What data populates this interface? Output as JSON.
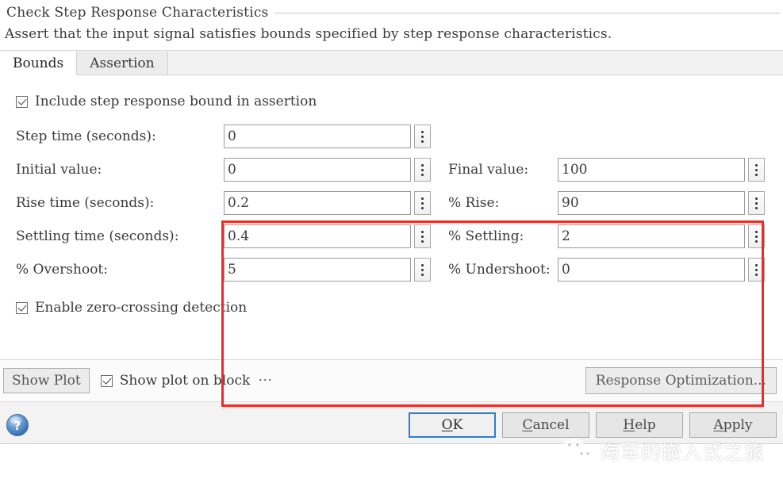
{
  "header": {
    "title": "Check Step Response Characteristics",
    "subtitle": "Assert that the input signal satisfies bounds specified by step response characteristics."
  },
  "tabs": [
    {
      "label": "Bounds",
      "active": true
    },
    {
      "label": "Assertion",
      "active": false
    }
  ],
  "panel": {
    "include_bound_checkbox": {
      "label": "Include step response bound in assertion",
      "checked": true
    },
    "fields": [
      {
        "left_label": "Step time (seconds):",
        "left_value": "0",
        "right_label": "",
        "right_value": null
      },
      {
        "left_label": "Initial value:",
        "left_value": "0",
        "right_label": "Final value:",
        "right_value": "100"
      },
      {
        "left_label": "Rise time (seconds):",
        "left_value": "0.2",
        "right_label": "% Rise:",
        "right_value": "90"
      },
      {
        "left_label": "Settling time (seconds):",
        "left_value": "0.4",
        "right_label": "% Settling:",
        "right_value": "2"
      },
      {
        "left_label": "% Overshoot:",
        "left_value": "5",
        "right_label": "% Undershoot:",
        "right_value": "0"
      }
    ],
    "zero_crossing_checkbox": {
      "label": "Enable zero-crossing detection",
      "checked": true
    },
    "annotation_rect_color": "#ee2b24"
  },
  "toolbar": {
    "show_plot_label": "Show Plot",
    "show_plot_on_block": {
      "label": "Show plot on block",
      "checked": true
    },
    "overflow_label": "⋯",
    "response_optimization_label": "Response Optimization..."
  },
  "footer": {
    "help_icon": "help-question-icon",
    "buttons": [
      {
        "label": "OK",
        "mnemonic": "O",
        "primary": true
      },
      {
        "label": "Cancel",
        "mnemonic": "C",
        "primary": false
      },
      {
        "label": "Help",
        "mnemonic": "H",
        "primary": false
      },
      {
        "label": "Apply",
        "mnemonic": "A",
        "primary": false
      }
    ]
  },
  "watermark": {
    "text": "海军的嵌入式之旅",
    "logo": "wechat-logo-icon"
  }
}
